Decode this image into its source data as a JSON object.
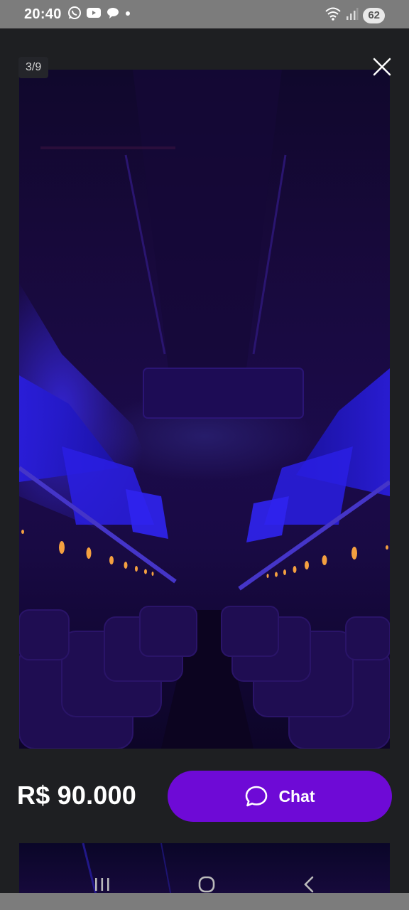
{
  "status_bar": {
    "time": "20:40",
    "battery": "62",
    "notification_icons": [
      "whatsapp-icon",
      "youtube-icon",
      "chat-bubble-icon",
      "dot-icon"
    ],
    "system_icons": [
      "wifi-icon",
      "signal-icon"
    ]
  },
  "viewer": {
    "counter": "3/9",
    "close_icon": "close-icon",
    "photo_alt": "bus-interior-blue-lighting"
  },
  "listing": {
    "price": "R$ 90.000",
    "chat_label": "Chat",
    "chat_icon": "chat-bubble-icon",
    "accent_color": "#6e0ad6"
  },
  "nav_bar": {
    "items": [
      "recents-icon",
      "home-icon",
      "back-icon"
    ]
  }
}
